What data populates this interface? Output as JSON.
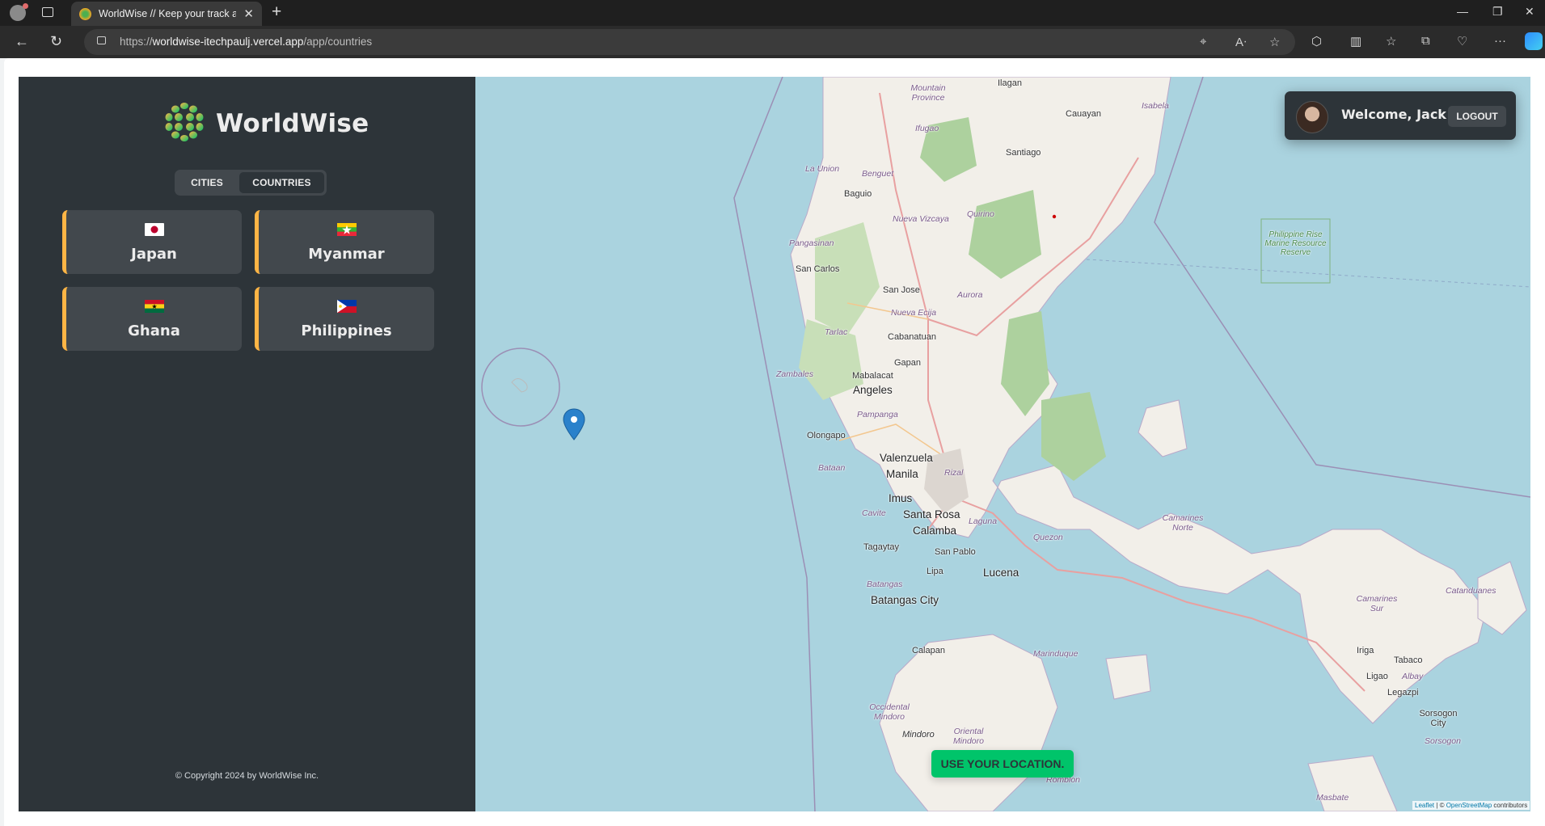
{
  "browser": {
    "tab_title": "WorldWise // Keep your track ad",
    "url_prefix": "https://",
    "url_host": "worldwise-itechpaulj.vercel.app",
    "url_path": "/app/countries"
  },
  "app": {
    "brand": "WorldWise",
    "toggle": {
      "cities": "CITIES",
      "countries": "COUNTRIES",
      "active": "COUNTRIES"
    },
    "countries": [
      {
        "name": "Japan",
        "flag": "japan-flag-icon"
      },
      {
        "name": "Myanmar",
        "flag": "myanmar-flag-icon"
      },
      {
        "name": "Ghana",
        "flag": "ghana-flag-icon"
      },
      {
        "name": "Philippines",
        "flag": "philippines-flag-icon"
      }
    ],
    "copyright": "© Copyright 2024 by WorldWise Inc.",
    "accent_color": "#ffb545",
    "brand_color": "#00c46a"
  },
  "map": {
    "user": {
      "welcome": "Welcome, Jack",
      "logout": "LOGOUT"
    },
    "use_location": "USE YOUR LOCATION.",
    "places": {
      "ilagan": "Ilagan",
      "mountain_province": "Mountain Province",
      "isabela": "Isabela",
      "cauayan": "Cauayan",
      "ifugao": "Ifugao",
      "santiago": "Santiago",
      "la_union": "La Union",
      "benguet": "Benguet",
      "baguio": "Baguio",
      "quirino": "Quirino",
      "nueva_vizcaya": "Nueva Vizcaya",
      "pangasinan": "Pangasinan",
      "san_carlos": "San Carlos",
      "san_jose": "San Jose",
      "aurora": "Aurora",
      "nueva_ecija": "Nueva Ecija",
      "tarlac": "Tarlac",
      "cabanatuan": "Cabanatuan",
      "gapan": "Gapan",
      "zambales": "Zambales",
      "mabalacat": "Mabalacat",
      "angeles": "Angeles",
      "pampanga": "Pampanga",
      "olongapo": "Olongapo",
      "valenzuela": "Valenzuela",
      "manila": "Manila",
      "bataan": "Bataan",
      "rizal": "Rizal",
      "imus": "Imus",
      "cavite": "Cavite",
      "santa_rosa": "Santa Rosa",
      "laguna": "Laguna",
      "calamba": "Calamba",
      "tagaytay": "Tagaytay",
      "san_pablo": "San Pablo",
      "lipa": "Lipa",
      "lucena": "Lucena",
      "quezon": "Quezon",
      "batangas": "Batangas",
      "batangas_city": "Batangas City",
      "camarines_norte": "Camarines Norte",
      "camarines_sur": "Camarines Sur",
      "catanduanes": "Catanduanes",
      "iriga": "Iriga",
      "tabaco": "Tabaco",
      "ligao": "Ligao",
      "albay": "Albay",
      "legazpi": "Legazpi",
      "sorsogon_city": "Sorsogon City",
      "sorsogon": "Sorsogon",
      "calapan": "Calapan",
      "marinduque": "Marinduque",
      "occidental_mindoro": "Occidental Mindoro",
      "oriental_mindoro": "Oriental Mindoro",
      "mindoro": "Mindoro",
      "romblon": "Romblon",
      "masbate": "Masbate",
      "reserve": "Philippine Rise Marine Resource Reserve"
    },
    "attribution": {
      "leaflet": "Leaflet",
      "osm_prefix": "| ©",
      "osm": "OpenStreetMap",
      "suffix": "contributors"
    }
  }
}
